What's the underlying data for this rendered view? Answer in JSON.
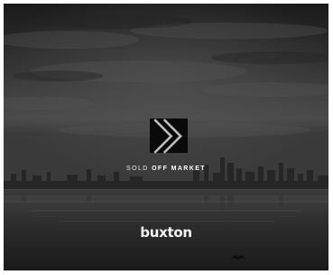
{
  "tagline": {
    "part1": "SOLD ",
    "part2": "OFF MARKET"
  },
  "brand": {
    "name": "buxton"
  },
  "badge": {
    "icon": "chevron-right-icon"
  },
  "colors": {
    "sky_top": "#1c1c1c",
    "sky_mid": "#3e3e3e",
    "water": "#2a2a2a",
    "badge_bg": "#0a0a0a",
    "text": "#e8e8e8"
  }
}
